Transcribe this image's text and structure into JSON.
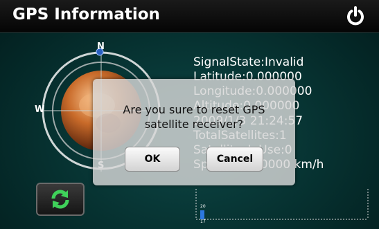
{
  "header": {
    "title": "GPS Information",
    "power_icon": "power-icon"
  },
  "compass": {
    "north": "N",
    "west": "W",
    "south": "S"
  },
  "info": {
    "signal_state": "SignalState:Invalid",
    "latitude": "Latitude:0.000000",
    "longitude": "Longitude:0.000000",
    "altitude": "Altitude:0.000000",
    "datetime": "2009/1/3 21:24:57",
    "total_satellites": "TotalSatellites:1",
    "satellites_in_use": "SatellitesInUse:0",
    "speed": "Speed:0.000000 km/h"
  },
  "refresh_button": {
    "icon": "refresh-icon"
  },
  "signal_graph": {
    "bar_value": "17",
    "tick_label": "20"
  },
  "dialog": {
    "message_line1": "Are you sure to reset GPS",
    "message_line2": "satellite receiver?",
    "ok_label": "OK",
    "cancel_label": "Cancel"
  }
}
